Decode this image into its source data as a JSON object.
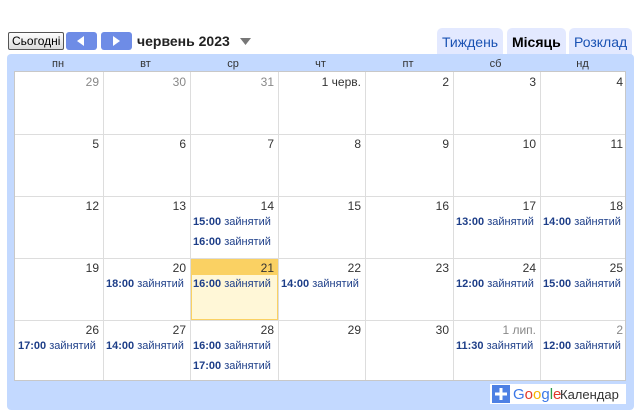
{
  "toolbar": {
    "today_label": "Сьогодні",
    "current_period": "червень 2023",
    "tabs": {
      "week": "Тиждень",
      "month": "Місяць",
      "agenda": "Розклад"
    }
  },
  "weekdays": [
    "пн",
    "вт",
    "ср",
    "чт",
    "пт",
    "сб",
    "нд"
  ],
  "weeks": [
    {
      "days": [
        {
          "label": "29",
          "outside": true,
          "events": []
        },
        {
          "label": "30",
          "outside": true,
          "events": []
        },
        {
          "label": "31",
          "outside": true,
          "events": []
        },
        {
          "label": "1 черв.",
          "outside": false,
          "events": []
        },
        {
          "label": "2",
          "outside": false,
          "events": []
        },
        {
          "label": "3",
          "outside": false,
          "events": []
        },
        {
          "label": "4",
          "outside": false,
          "events": []
        }
      ]
    },
    {
      "days": [
        {
          "label": "5",
          "outside": false,
          "events": []
        },
        {
          "label": "6",
          "outside": false,
          "events": []
        },
        {
          "label": "7",
          "outside": false,
          "events": []
        },
        {
          "label": "8",
          "outside": false,
          "events": []
        },
        {
          "label": "9",
          "outside": false,
          "events": []
        },
        {
          "label": "10",
          "outside": false,
          "events": []
        },
        {
          "label": "11",
          "outside": false,
          "events": []
        }
      ]
    },
    {
      "days": [
        {
          "label": "12",
          "outside": false,
          "events": []
        },
        {
          "label": "13",
          "outside": false,
          "events": []
        },
        {
          "label": "14",
          "outside": false,
          "events": [
            {
              "time": "15:00",
              "title": "зайнятий"
            },
            {
              "time": "16:00",
              "title": "зайнятий"
            }
          ]
        },
        {
          "label": "15",
          "outside": false,
          "events": []
        },
        {
          "label": "16",
          "outside": false,
          "events": []
        },
        {
          "label": "17",
          "outside": false,
          "events": [
            {
              "time": "13:00",
              "title": "зайнятий"
            }
          ]
        },
        {
          "label": "18",
          "outside": false,
          "events": [
            {
              "time": "14:00",
              "title": "зайнятий"
            }
          ]
        }
      ]
    },
    {
      "days": [
        {
          "label": "19",
          "outside": false,
          "events": []
        },
        {
          "label": "20",
          "outside": false,
          "events": [
            {
              "time": "18:00",
              "title": "зайнятий"
            }
          ]
        },
        {
          "label": "21",
          "outside": false,
          "today": true,
          "events": [
            {
              "time": "16:00",
              "title": "зайнятий"
            }
          ]
        },
        {
          "label": "22",
          "outside": false,
          "events": [
            {
              "time": "14:00",
              "title": "зайнятий"
            }
          ]
        },
        {
          "label": "23",
          "outside": false,
          "events": []
        },
        {
          "label": "24",
          "outside": false,
          "events": [
            {
              "time": "12:00",
              "title": "зайнятий"
            }
          ]
        },
        {
          "label": "25",
          "outside": false,
          "events": [
            {
              "time": "15:00",
              "title": "зайнятий"
            }
          ]
        }
      ]
    },
    {
      "days": [
        {
          "label": "26",
          "outside": false,
          "events": [
            {
              "time": "17:00",
              "title": "зайнятий"
            }
          ]
        },
        {
          "label": "27",
          "outside": false,
          "events": [
            {
              "time": "14:00",
              "title": "зайнятий"
            }
          ]
        },
        {
          "label": "28",
          "outside": false,
          "events": [
            {
              "time": "16:00",
              "title": "зайнятий"
            },
            {
              "time": "17:00",
              "title": "зайнятий"
            }
          ]
        },
        {
          "label": "29",
          "outside": false,
          "events": []
        },
        {
          "label": "30",
          "outside": false,
          "events": []
        },
        {
          "label": "1 лип.",
          "outside": true,
          "events": [
            {
              "time": "11:30",
              "title": "зайнятий"
            }
          ]
        },
        {
          "label": "2",
          "outside": true,
          "events": [
            {
              "time": "12:00",
              "title": "зайнятий"
            }
          ]
        }
      ]
    }
  ],
  "footer": {
    "logo_word": "Google",
    "product_label": "Календар",
    "icon": "plus-icon"
  },
  "colors": {
    "frame": "#c3d9ff",
    "nav_button": "#6e8ce6",
    "event_text": "#1d3e88",
    "today_highlight": "#fad163",
    "today_fill": "#fff7d7"
  }
}
